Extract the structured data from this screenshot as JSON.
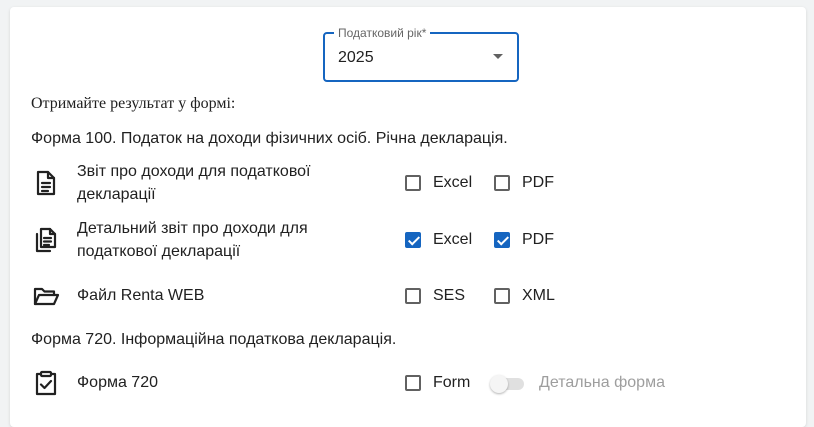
{
  "tax_year": {
    "label": "Податковий рік*",
    "value": "2025"
  },
  "hint": "Отримайте результат у формі:",
  "form100": {
    "title": "Форма 100. Податок на доходи фізичних осіб. Річна декларація.",
    "rows": [
      {
        "icon": "document-icon",
        "label": "Звіт про доходи для податкової декларації",
        "options": [
          {
            "label": "Excel",
            "checked": false
          },
          {
            "label": "PDF",
            "checked": false
          }
        ]
      },
      {
        "icon": "documents-icon",
        "label": "Детальний звіт про доходи для податкової декларації",
        "options": [
          {
            "label": "Excel",
            "checked": true
          },
          {
            "label": "PDF",
            "checked": true
          }
        ]
      },
      {
        "icon": "folder-open-icon",
        "label": "Файл Renta WEB",
        "options": [
          {
            "label": "SES",
            "checked": false
          },
          {
            "label": "XML",
            "checked": false
          }
        ]
      }
    ]
  },
  "form720": {
    "title": "Форма 720. Інформаційна податкова декларація.",
    "row": {
      "icon": "clipboard-check-icon",
      "label": "Форма 720",
      "option": {
        "label": "Form",
        "checked": false
      },
      "toggle": {
        "label": "Детальна форма",
        "on": false,
        "disabled": true
      }
    }
  },
  "colors": {
    "accent": "#1565c0",
    "disabled_text": "#9e9e9e"
  }
}
